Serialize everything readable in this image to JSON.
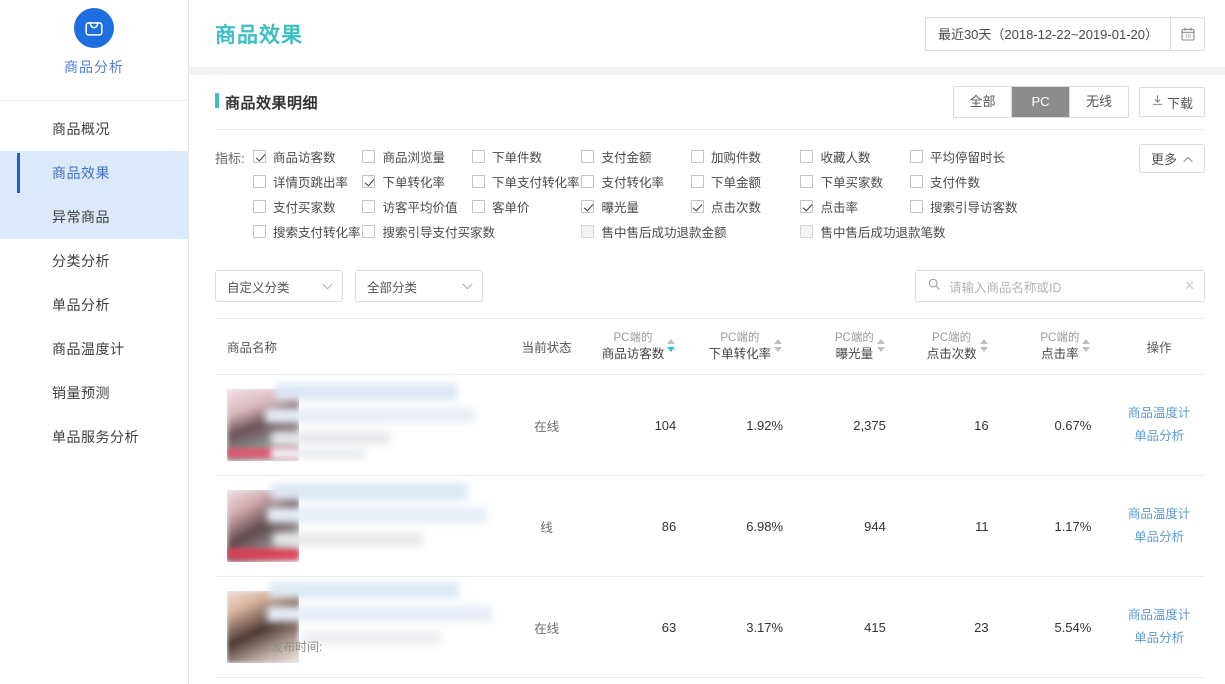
{
  "sidebar": {
    "brand": {
      "name": "商品分析",
      "icon": "shopping-bag-icon"
    },
    "items": [
      {
        "label": "商品概况",
        "active": false
      },
      {
        "label": "商品效果",
        "active": true
      },
      {
        "label": "异常商品",
        "active": false
      },
      {
        "label": "分类分析",
        "active": false
      },
      {
        "label": "单品分析",
        "active": false
      },
      {
        "label": "商品温度计",
        "active": false
      },
      {
        "label": "销量预测",
        "active": false
      },
      {
        "label": "单品服务分析",
        "active": false
      }
    ]
  },
  "topbar": {
    "title": "商品效果",
    "daterange": "最近30天（2018-12-22~2019-01-20）",
    "calendar_icon": "calendar-icon"
  },
  "card": {
    "title": "商品效果明细",
    "segments": [
      {
        "label": "全部",
        "selected": false
      },
      {
        "label": "PC",
        "selected": true
      },
      {
        "label": "无线",
        "selected": false
      }
    ],
    "download_label": "下载",
    "download_icon": "download-icon"
  },
  "metrics": {
    "label": "指标:",
    "more_label": "更多",
    "more_icon": "chevron-up-icon",
    "items": [
      {
        "label": "商品访客数",
        "checked": true,
        "dim": false
      },
      {
        "label": "商品浏览量",
        "checked": false,
        "dim": false
      },
      {
        "label": "下单件数",
        "checked": false,
        "dim": false
      },
      {
        "label": "支付金额",
        "checked": false,
        "dim": false
      },
      {
        "label": "加购件数",
        "checked": false,
        "dim": false
      },
      {
        "label": "收藏人数",
        "checked": false,
        "dim": false
      },
      {
        "label": "平均停留时长",
        "checked": false,
        "dim": false
      },
      {
        "label": "",
        "checked": false,
        "dim": false
      },
      {
        "label": "详情页跳出率",
        "checked": false,
        "dim": false
      },
      {
        "label": "下单转化率",
        "checked": true,
        "dim": false
      },
      {
        "label": "下单支付转化率",
        "checked": false,
        "dim": false
      },
      {
        "label": "支付转化率",
        "checked": false,
        "dim": false
      },
      {
        "label": "下单金额",
        "checked": false,
        "dim": false
      },
      {
        "label": "下单买家数",
        "checked": false,
        "dim": false
      },
      {
        "label": "支付件数",
        "checked": false,
        "dim": false
      },
      {
        "label": "",
        "checked": false,
        "dim": false
      },
      {
        "label": "支付买家数",
        "checked": false,
        "dim": false
      },
      {
        "label": "访客平均价值",
        "checked": false,
        "dim": false
      },
      {
        "label": "客单价",
        "checked": false,
        "dim": false
      },
      {
        "label": "曝光量",
        "checked": true,
        "dim": false
      },
      {
        "label": "点击次数",
        "checked": true,
        "dim": false
      },
      {
        "label": "点击率",
        "checked": true,
        "dim": false
      },
      {
        "label": "搜索引导访客数",
        "checked": false,
        "dim": false
      },
      {
        "label": "",
        "checked": false,
        "dim": false
      },
      {
        "label": "搜索支付转化率",
        "checked": false,
        "dim": false
      },
      {
        "label": "搜索引导支付买家数",
        "checked": false,
        "dim": false
      },
      {
        "label": "售中售后成功退款金额",
        "checked": false,
        "dim": true
      },
      {
        "label": "",
        "checked": false,
        "dim": false
      },
      {
        "label": "售中售后成功退款笔数",
        "checked": false,
        "dim": true
      },
      {
        "label": "",
        "checked": false,
        "dim": false
      },
      {
        "label": "",
        "checked": false,
        "dim": false
      },
      {
        "label": "",
        "checked": false,
        "dim": false
      }
    ]
  },
  "filters": {
    "category_select": "自定义分类",
    "all_category_select": "全部分类",
    "chevron_icon": "chevron-down-icon",
    "search_icon": "search-icon",
    "search_value": "",
    "search_placeholder": "请输入商品名称或ID",
    "clear_icon": "clear-icon"
  },
  "table": {
    "columns": [
      {
        "key": "name",
        "top": "",
        "label": "商品名称",
        "sortable": false
      },
      {
        "key": "status",
        "top": "",
        "label": "当前状态",
        "sortable": false
      },
      {
        "key": "uv",
        "top": "PC端的",
        "label": "商品访客数",
        "sortable": true,
        "sort": "desc"
      },
      {
        "key": "cvr",
        "top": "PC端的",
        "label": "下单转化率",
        "sortable": true,
        "sort": "none"
      },
      {
        "key": "imp",
        "top": "PC端的",
        "label": "曝光量",
        "sortable": true,
        "sort": "none"
      },
      {
        "key": "clicks",
        "top": "PC端的",
        "label": "点击次数",
        "sortable": true,
        "sort": "none"
      },
      {
        "key": "ctr",
        "top": "PC端的",
        "label": "点击率",
        "sortable": true,
        "sort": "none"
      },
      {
        "key": "op",
        "top": "",
        "label": "操作",
        "sortable": false
      }
    ],
    "rows": [
      {
        "name": "",
        "status": "在线",
        "uv": "104",
        "cvr": "1.92%",
        "imp": "2,375",
        "clicks": "16",
        "ctr": "0.67%",
        "ops": [
          "商品温度计",
          "单品分析"
        ]
      },
      {
        "name": "",
        "status": "线",
        "uv": "86",
        "cvr": "6.98%",
        "imp": "944",
        "clicks": "11",
        "ctr": "1.17%",
        "ops": [
          "商品温度计",
          "单品分析"
        ]
      },
      {
        "name": "发布时间:",
        "status": "在线",
        "uv": "63",
        "cvr": "3.17%",
        "imp": "415",
        "clicks": "23",
        "ctr": "5.54%",
        "ops": [
          "商品温度计",
          "单品分析"
        ]
      }
    ]
  },
  "colors": {
    "accent_teal": "#3dbfc2",
    "brand_blue": "#1d6ee0",
    "link_blue": "#5a9bd5",
    "sort_active": "#2ec0dd",
    "active_nav_bg": "#dce9fb"
  }
}
